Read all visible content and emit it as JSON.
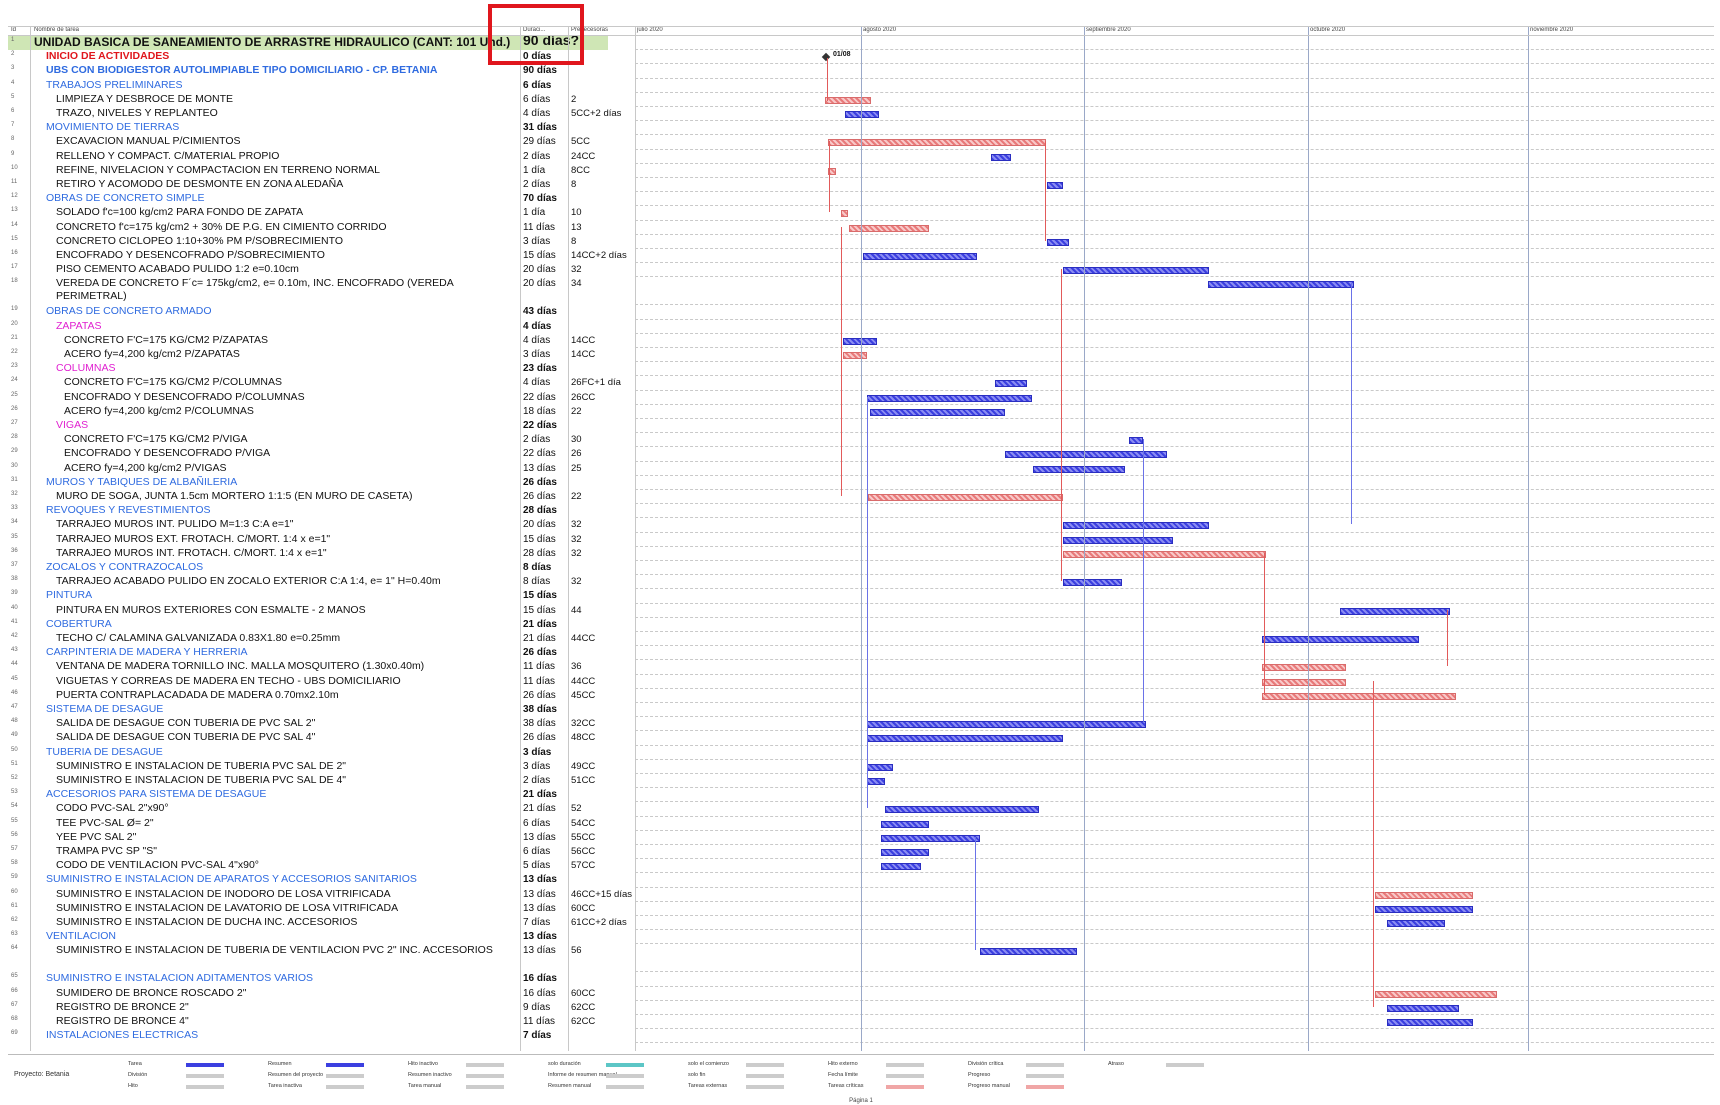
{
  "header": {
    "id": "Id",
    "name": "Nombre de tarea",
    "duration": "Duraci...",
    "predecessors": "Predecesoras",
    "months": [
      "julio 2020",
      "agosto 2020",
      "septiembre 2020",
      "octubre 2020",
      "noviembre 2020"
    ]
  },
  "milestone_label": "01/08",
  "tasks": [
    {
      "id": "1",
      "name": "UNIDAD BASICA DE SANEAMIENTO DE ARRASTRE HIDRAULICO (CANT: 101 Und.)",
      "dur": "90 días?",
      "pred": "",
      "level": 0,
      "type": "top"
    },
    {
      "id": "2",
      "name": "INICIO DE ACTIVIDADES",
      "dur": "0 días",
      "pred": "",
      "level": 1,
      "type": "red"
    },
    {
      "id": "3",
      "name": "UBS CON BIODIGESTOR AUTOLIMPIABLE TIPO DOMICILIARIO - CP. BETANIA",
      "dur": "90 días",
      "pred": "",
      "level": 1,
      "type": "blueb"
    },
    {
      "id": "4",
      "name": "TRABAJOS PRELIMINARES",
      "dur": "6 días",
      "pred": "",
      "level": 2,
      "type": "blue"
    },
    {
      "id": "5",
      "name": "LIMPIEZA Y DESBROCE DE MONTE",
      "dur": "6 días",
      "pred": "2",
      "level": 3
    },
    {
      "id": "6",
      "name": "TRAZO, NIVELES Y REPLANTEO",
      "dur": "4 días",
      "pred": "5CC+2 días",
      "level": 3
    },
    {
      "id": "7",
      "name": "MOVIMIENTO DE TIERRAS",
      "dur": "31 días",
      "pred": "",
      "level": 2,
      "type": "blue"
    },
    {
      "id": "8",
      "name": "EXCAVACION MANUAL P/CIMIENTOS",
      "dur": "29 días",
      "pred": "5CC",
      "level": 3
    },
    {
      "id": "9",
      "name": "RELLENO Y COMPACT. C/MATERIAL PROPIO",
      "dur": "2 días",
      "pred": "24CC",
      "level": 3
    },
    {
      "id": "10",
      "name": "REFINE, NIVELACION Y COMPACTACION EN TERRENO NORMAL",
      "dur": "1 día",
      "pred": "8CC",
      "level": 3
    },
    {
      "id": "11",
      "name": "RETIRO Y ACOMODO DE DESMONTE EN ZONA ALEDAÑA",
      "dur": "2 días",
      "pred": "8",
      "level": 3
    },
    {
      "id": "12",
      "name": "OBRAS DE CONCRETO SIMPLE",
      "dur": "70 días",
      "pred": "",
      "level": 2,
      "type": "blue"
    },
    {
      "id": "13",
      "name": "SOLADO f'c=100 kg/cm2 PARA FONDO DE ZAPATA",
      "dur": "1 día",
      "pred": "10",
      "level": 3
    },
    {
      "id": "14",
      "name": "CONCRETO f'c=175 kg/cm2 + 30% DE P.G. EN CIMIENTO CORRIDO",
      "dur": "11 días",
      "pred": "13",
      "level": 3
    },
    {
      "id": "15",
      "name": "CONCRETO CICLOPEO 1:10+30% PM P/SOBRECIMIENTO",
      "dur": "3 días",
      "pred": "8",
      "level": 3
    },
    {
      "id": "16",
      "name": "ENCOFRADO Y DESENCOFRADO P/SOBRECIMIENTO",
      "dur": "15 días",
      "pred": "14CC+2 días",
      "level": 3
    },
    {
      "id": "17",
      "name": "PISO CEMENTO ACABADO PULIDO 1:2 e=0.10cm",
      "dur": "20 días",
      "pred": "32",
      "level": 3
    },
    {
      "id": "18",
      "name": "VEREDA DE CONCRETO F´c= 175kg/cm2, e= 0.10m, INC. ENCOFRADO (VEREDA PERIMETRAL)",
      "dur": "20 días",
      "pred": "34",
      "level": 3,
      "tall": true
    },
    {
      "id": "19",
      "name": "OBRAS DE CONCRETO ARMADO",
      "dur": "43 días",
      "pred": "",
      "level": 2,
      "type": "blue"
    },
    {
      "id": "20",
      "name": "ZAPATAS",
      "dur": "4 días",
      "pred": "",
      "level": 3,
      "type": "mag"
    },
    {
      "id": "21",
      "name": "CONCRETO F'C=175 KG/CM2 P/ZAPATAS",
      "dur": "4 días",
      "pred": "14CC",
      "level": 4
    },
    {
      "id": "22",
      "name": "ACERO fy=4,200 kg/cm2 P/ZAPATAS",
      "dur": "3 días",
      "pred": "14CC",
      "level": 4
    },
    {
      "id": "23",
      "name": "COLUMNAS",
      "dur": "23 días",
      "pred": "",
      "level": 3,
      "type": "mag"
    },
    {
      "id": "24",
      "name": "CONCRETO F'C=175 KG/CM2 P/COLUMNAS",
      "dur": "4 días",
      "pred": "26FC+1 día",
      "level": 4
    },
    {
      "id": "25",
      "name": "ENCOFRADO Y DESENCOFRADO P/COLUMNAS",
      "dur": "22 días",
      "pred": "26CC",
      "level": 4
    },
    {
      "id": "26",
      "name": "ACERO fy=4,200 kg/cm2 P/COLUMNAS",
      "dur": "18 días",
      "pred": "22",
      "level": 4
    },
    {
      "id": "27",
      "name": "VIGAS",
      "dur": "22 días",
      "pred": "",
      "level": 3,
      "type": "mag"
    },
    {
      "id": "28",
      "name": "CONCRETO F'C=175 KG/CM2 P/VIGA",
      "dur": "2 días",
      "pred": "30",
      "level": 4
    },
    {
      "id": "29",
      "name": "ENCOFRADO Y DESENCOFRADO P/VIGA",
      "dur": "22 días",
      "pred": "26",
      "level": 4
    },
    {
      "id": "30",
      "name": "ACERO fy=4,200 kg/cm2 P/VIGAS",
      "dur": "13 días",
      "pred": "25",
      "level": 4
    },
    {
      "id": "31",
      "name": "MUROS Y TABIQUES DE ALBAÑILERIA",
      "dur": "26 días",
      "pred": "",
      "level": 2,
      "type": "blue"
    },
    {
      "id": "32",
      "name": "MURO DE SOGA, JUNTA 1.5cm MORTERO 1:1:5 (EN MURO DE CASETA)",
      "dur": "26 días",
      "pred": "22",
      "level": 3
    },
    {
      "id": "33",
      "name": "REVOQUES Y REVESTIMIENTOS",
      "dur": "28 días",
      "pred": "",
      "level": 2,
      "type": "blue"
    },
    {
      "id": "34",
      "name": "TARRAJEO MUROS INT. PULIDO M=1:3 C:A e=1\"",
      "dur": "20 días",
      "pred": "32",
      "level": 3
    },
    {
      "id": "35",
      "name": "TARRAJEO MUROS EXT. FROTACH. C/MORT. 1:4 x e=1\"",
      "dur": "15 días",
      "pred": "32",
      "level": 3
    },
    {
      "id": "36",
      "name": "TARRAJEO MUROS INT. FROTACH. C/MORT. 1:4 x e=1\"",
      "dur": "28 días",
      "pred": "32",
      "level": 3
    },
    {
      "id": "37",
      "name": "ZOCALOS Y CONTRAZOCALOS",
      "dur": "8 días",
      "pred": "",
      "level": 2,
      "type": "blue"
    },
    {
      "id": "38",
      "name": "TARRAJEO ACABADO PULIDO EN ZOCALO EXTERIOR C:A 1:4, e= 1\" H=0.40m",
      "dur": "8 días",
      "pred": "32",
      "level": 3
    },
    {
      "id": "39",
      "name": "PINTURA",
      "dur": "15 días",
      "pred": "",
      "level": 2,
      "type": "blue"
    },
    {
      "id": "40",
      "name": "PINTURA EN MUROS EXTERIORES CON ESMALTE - 2 MANOS",
      "dur": "15 días",
      "pred": "44",
      "level": 3
    },
    {
      "id": "41",
      "name": "COBERTURA",
      "dur": "21 días",
      "pred": "",
      "level": 2,
      "type": "blue"
    },
    {
      "id": "42",
      "name": "TECHO C/ CALAMINA GALVANIZADA 0.83X1.80 e=0.25mm",
      "dur": "21 días",
      "pred": "44CC",
      "level": 3
    },
    {
      "id": "43",
      "name": "CARPINTERIA DE MADERA Y HERRERIA",
      "dur": "26 días",
      "pred": "",
      "level": 2,
      "type": "blue"
    },
    {
      "id": "44",
      "name": "VENTANA DE MADERA TORNILLO INC. MALLA MOSQUITERO (1.30x0.40m)",
      "dur": "11 días",
      "pred": "36",
      "level": 3
    },
    {
      "id": "45",
      "name": "VIGUETAS Y CORREAS DE MADERA EN TECHO - UBS DOMICILIARIO",
      "dur": "11 días",
      "pred": "44CC",
      "level": 3
    },
    {
      "id": "46",
      "name": "PUERTA CONTRAPLACADADA DE MADERA 0.70mx2.10m",
      "dur": "26 días",
      "pred": "45CC",
      "level": 3
    },
    {
      "id": "47",
      "name": "SISTEMA DE DESAGUE",
      "dur": "38 días",
      "pred": "",
      "level": 2,
      "type": "blue"
    },
    {
      "id": "48",
      "name": "SALIDA DE DESAGUE CON TUBERIA DE PVC SAL 2\"",
      "dur": "38 días",
      "pred": "32CC",
      "level": 3
    },
    {
      "id": "49",
      "name": "SALIDA DE DESAGUE CON TUBERIA DE PVC SAL 4\"",
      "dur": "26 días",
      "pred": "48CC",
      "level": 3
    },
    {
      "id": "50",
      "name": "TUBERIA DE DESAGUE",
      "dur": "3 días",
      "pred": "",
      "level": 2,
      "type": "blue"
    },
    {
      "id": "51",
      "name": "SUMINISTRO E INSTALACION DE TUBERIA PVC SAL DE 2\"",
      "dur": "3 días",
      "pred": "49CC",
      "level": 3
    },
    {
      "id": "52",
      "name": "SUMINISTRO E INSTALACION DE TUBERIA PVC SAL DE 4\"",
      "dur": "2 días",
      "pred": "51CC",
      "level": 3
    },
    {
      "id": "53",
      "name": "ACCESORIOS PARA SISTEMA DE DESAGUE",
      "dur": "21 días",
      "pred": "",
      "level": 2,
      "type": "blue"
    },
    {
      "id": "54",
      "name": "CODO PVC-SAL 2\"x90°",
      "dur": "21 días",
      "pred": "52",
      "level": 3
    },
    {
      "id": "55",
      "name": "TEE PVC-SAL Ø= 2\"",
      "dur": "6 días",
      "pred": "54CC",
      "level": 3
    },
    {
      "id": "56",
      "name": "YEE PVC SAL 2\"",
      "dur": "13 días",
      "pred": "55CC",
      "level": 3
    },
    {
      "id": "57",
      "name": "TRAMPA PVC SP \"S\"",
      "dur": "6 días",
      "pred": "56CC",
      "level": 3
    },
    {
      "id": "58",
      "name": "CODO DE VENTILACION PVC-SAL 4\"x90°",
      "dur": "5 días",
      "pred": "57CC",
      "level": 3
    },
    {
      "id": "59",
      "name": "SUMINISTRO E INSTALACION DE APARATOS Y ACCESORIOS SANITARIOS",
      "dur": "13 días",
      "pred": "",
      "level": 2,
      "type": "blue"
    },
    {
      "id": "60",
      "name": "SUMINISTRO E INSTALACION DE INODORO DE LOSA VITRIFICADA",
      "dur": "13 días",
      "pred": "46CC+15 días",
      "level": 3
    },
    {
      "id": "61",
      "name": "SUMINISTRO E INSTALACION DE LAVATORIO DE LOSA VITRIFICADA",
      "dur": "13 días",
      "pred": "60CC",
      "level": 3
    },
    {
      "id": "62",
      "name": "SUMINISTRO E INSTALACION DE DUCHA INC. ACCESORIOS",
      "dur": "7 días",
      "pred": "61CC+2 días",
      "level": 3
    },
    {
      "id": "63",
      "name": "VENTILACION",
      "dur": "13 días",
      "pred": "",
      "level": 2,
      "type": "blue"
    },
    {
      "id": "64",
      "name": "SUMINISTRO E INSTALACION DE TUBERIA DE VENTILACION PVC 2\" INC. ACCESORIOS",
      "dur": "13 días",
      "pred": "56",
      "level": 3,
      "tall": true
    },
    {
      "id": "65",
      "name": "SUMINISTRO E INSTALACION ADITAMENTOS VARIOS",
      "dur": "16 días",
      "pred": "",
      "level": 2,
      "type": "blue"
    },
    {
      "id": "66",
      "name": "SUMIDERO DE BRONCE ROSCADO 2\"",
      "dur": "16 días",
      "pred": "60CC",
      "level": 3
    },
    {
      "id": "67",
      "name": "REGISTRO DE BRONCE 2\"",
      "dur": "9 días",
      "pred": "62CC",
      "level": 3
    },
    {
      "id": "68",
      "name": "REGISTRO DE BRONCE 4\"",
      "dur": "11 días",
      "pred": "62CC",
      "level": 3
    },
    {
      "id": "69",
      "name": "INSTALACIONES ELECTRICAS",
      "dur": "7 días",
      "pred": "",
      "level": 2,
      "type": "blue"
    }
  ],
  "legend": {
    "project": "Proyecto: Betania",
    "items": [
      "Tarea",
      "División",
      "Hito",
      "Resumen",
      "Resumen del proyecto",
      "Tarea inactiva",
      "Hito inactivo",
      "Resumen inactivo",
      "Tarea manual",
      "solo duración",
      "Informe de resumen manual",
      "Resumen manual",
      "solo el comienzo",
      "solo fin",
      "Tareas externas",
      "Hito externo",
      "Fecha límite",
      "Tareas críticas",
      "División crítica",
      "Progreso",
      "Progreso manual",
      "Atraso"
    ]
  },
  "page_label": "Página 1",
  "colors": {
    "summary_blue": "#2f6be0",
    "top_bg": "#cfe6b5",
    "red": "#e0161d",
    "magenta": "#e020d0",
    "bar_blue": "#3b3fe0",
    "bar_red": "#e87a7a"
  }
}
